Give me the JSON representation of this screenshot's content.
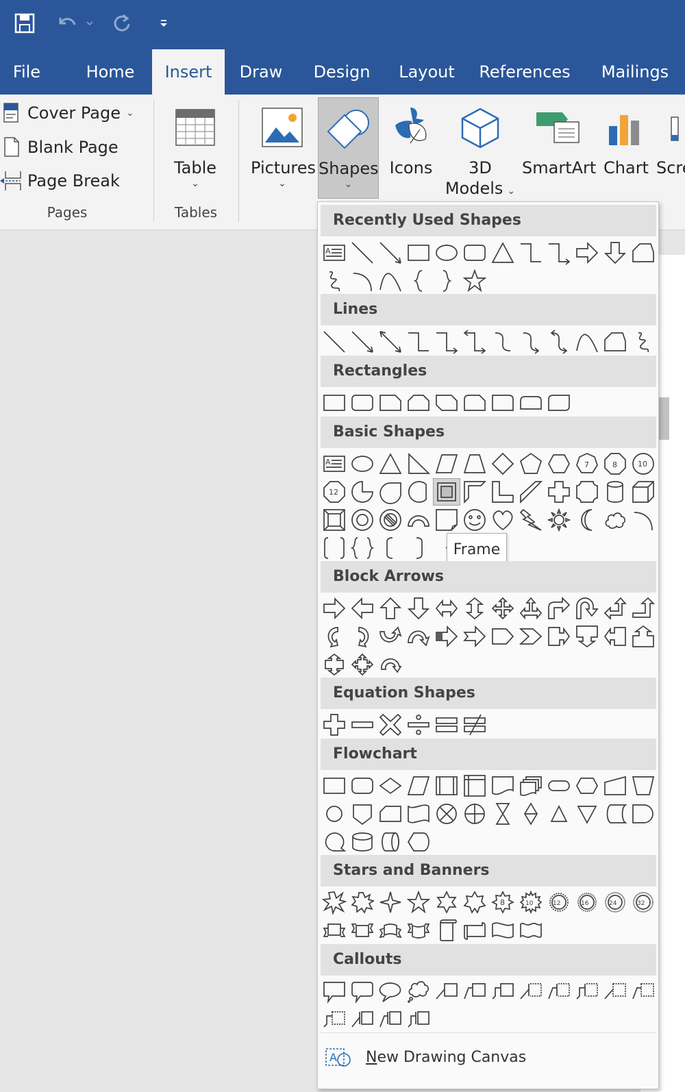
{
  "quick_access": {
    "icons": [
      "save-icon",
      "undo-icon",
      "redo-icon",
      "customize-icon"
    ]
  },
  "tabs": [
    {
      "id": "file",
      "label": "File"
    },
    {
      "id": "home",
      "label": "Home"
    },
    {
      "id": "insert",
      "label": "Insert",
      "active": true
    },
    {
      "id": "draw",
      "label": "Draw"
    },
    {
      "id": "design",
      "label": "Design"
    },
    {
      "id": "layout",
      "label": "Layout"
    },
    {
      "id": "references",
      "label": "References"
    },
    {
      "id": "mailings",
      "label": "Mailings"
    }
  ],
  "ribbon": {
    "pages": {
      "cover_page": "Cover Page",
      "blank_page": "Blank Page",
      "page_break": "Page Break",
      "group_label": "Pages"
    },
    "tables": {
      "table": "Table",
      "group_label": "Tables"
    },
    "illustrations": {
      "pictures": "Pictures",
      "shapes": "Shapes",
      "icons": "Icons",
      "models_3d_line1": "3D",
      "models_3d_line2": "Models",
      "smartart": "SmartArt",
      "chart": "Chart",
      "screenshot": "Scre"
    }
  },
  "shapes_menu": {
    "categories": {
      "recent": "Recently Used Shapes",
      "lines": "Lines",
      "rectangles": "Rectangles",
      "basic": "Basic Shapes",
      "block_arrows": "Block Arrows",
      "equation": "Equation Shapes",
      "flowchart": "Flowchart",
      "stars": "Stars and Banners",
      "callouts": "Callouts"
    },
    "tooltip": "Frame",
    "new_canvas_hotkey": "N",
    "new_canvas_rest": "ew Drawing Canvas"
  },
  "colors": {
    "title_bar": "#2b579a",
    "ribbon": "#f3f3f3",
    "menu_header": "#e1e1e1"
  }
}
